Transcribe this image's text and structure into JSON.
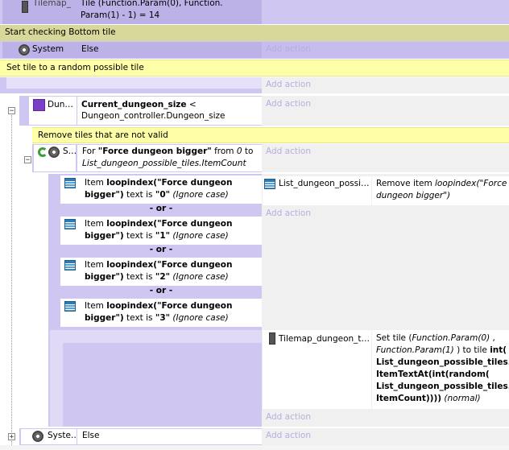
{
  "top_row": {
    "object": "Tilemap_",
    "action_line1": "Tile (Function.Param(0), Function.",
    "action_line2": "Param(1) - 1) = 14"
  },
  "comments": {
    "bottom": "Start checking Bottom tile",
    "random": "Set tile to a random possible tile",
    "remove": "Remove tiles that are not valid"
  },
  "system_else_1": {
    "object": "System",
    "condition": "Else",
    "add_action": "Add action"
  },
  "blank_row": {
    "add_action": "Add action"
  },
  "dungeon_row": {
    "object": "Dun…",
    "condition_bold": "Current_dungeon_size",
    "condition_op": " <",
    "condition_line2": "Dungeon_controller.Dungeon_size",
    "add_action": "Add action"
  },
  "for_row": {
    "object": "S…",
    "for_prefix": "For ",
    "for_name": "\"Force dungeon bigger\"",
    "from_text": " from ",
    "from_val": "0",
    "to_text": " to",
    "to_val": "List_dungeon_possible_tiles.ItemCount",
    "add_action": "Add action"
  },
  "item_conditions": [
    {
      "pre": "Item ",
      "bold": "loopindex(\"Force dungeon",
      "bold2": "bigger\")",
      "mid": " text is ",
      "val": "\"0\"",
      "ign": " (Ignore case)"
    },
    {
      "pre": "Item ",
      "bold": "loopindex(\"Force dungeon",
      "bold2": "bigger\")",
      "mid": " text is ",
      "val": "\"1\"",
      "ign": " (Ignore case)"
    },
    {
      "pre": "Item ",
      "bold": "loopindex(\"Force dungeon",
      "bold2": "bigger\")",
      "mid": " text is ",
      "val": "\"2\"",
      "ign": " (Ignore case)"
    },
    {
      "pre": "Item ",
      "bold": "loopindex(\"Force dungeon",
      "bold2": "bigger\")",
      "mid": " text is ",
      "val": "\"3\"",
      "ign": " (Ignore case)"
    }
  ],
  "or_label": "- or -",
  "remove_action": {
    "object": "List_dungeon_possi…",
    "text": "Remove item ",
    "ital1": "loopindex(\"Force",
    "ital2": "dungeon bigger\")",
    "add_action": "Add action"
  },
  "settile_action": {
    "object": "Tilemap_dungeon_t…",
    "l1a": "Set tile (",
    "l1b": "Function.Param(0)",
    "l1c": " ,",
    "l2a": "Function.Param(1)",
    "l2b": " ) to tile ",
    "l2c": "int(",
    "l3": "List_dungeon_possible_tiles.",
    "l4": "ItemTextAt(int(random(",
    "l5": "List_dungeon_possible_tiles.",
    "l6a": "ItemCount))))",
    "l6b": " (normal)",
    "add_action": "Add action"
  },
  "system_else_2": {
    "object": "Syste…",
    "condition": "Else",
    "add_action": "Add action"
  }
}
